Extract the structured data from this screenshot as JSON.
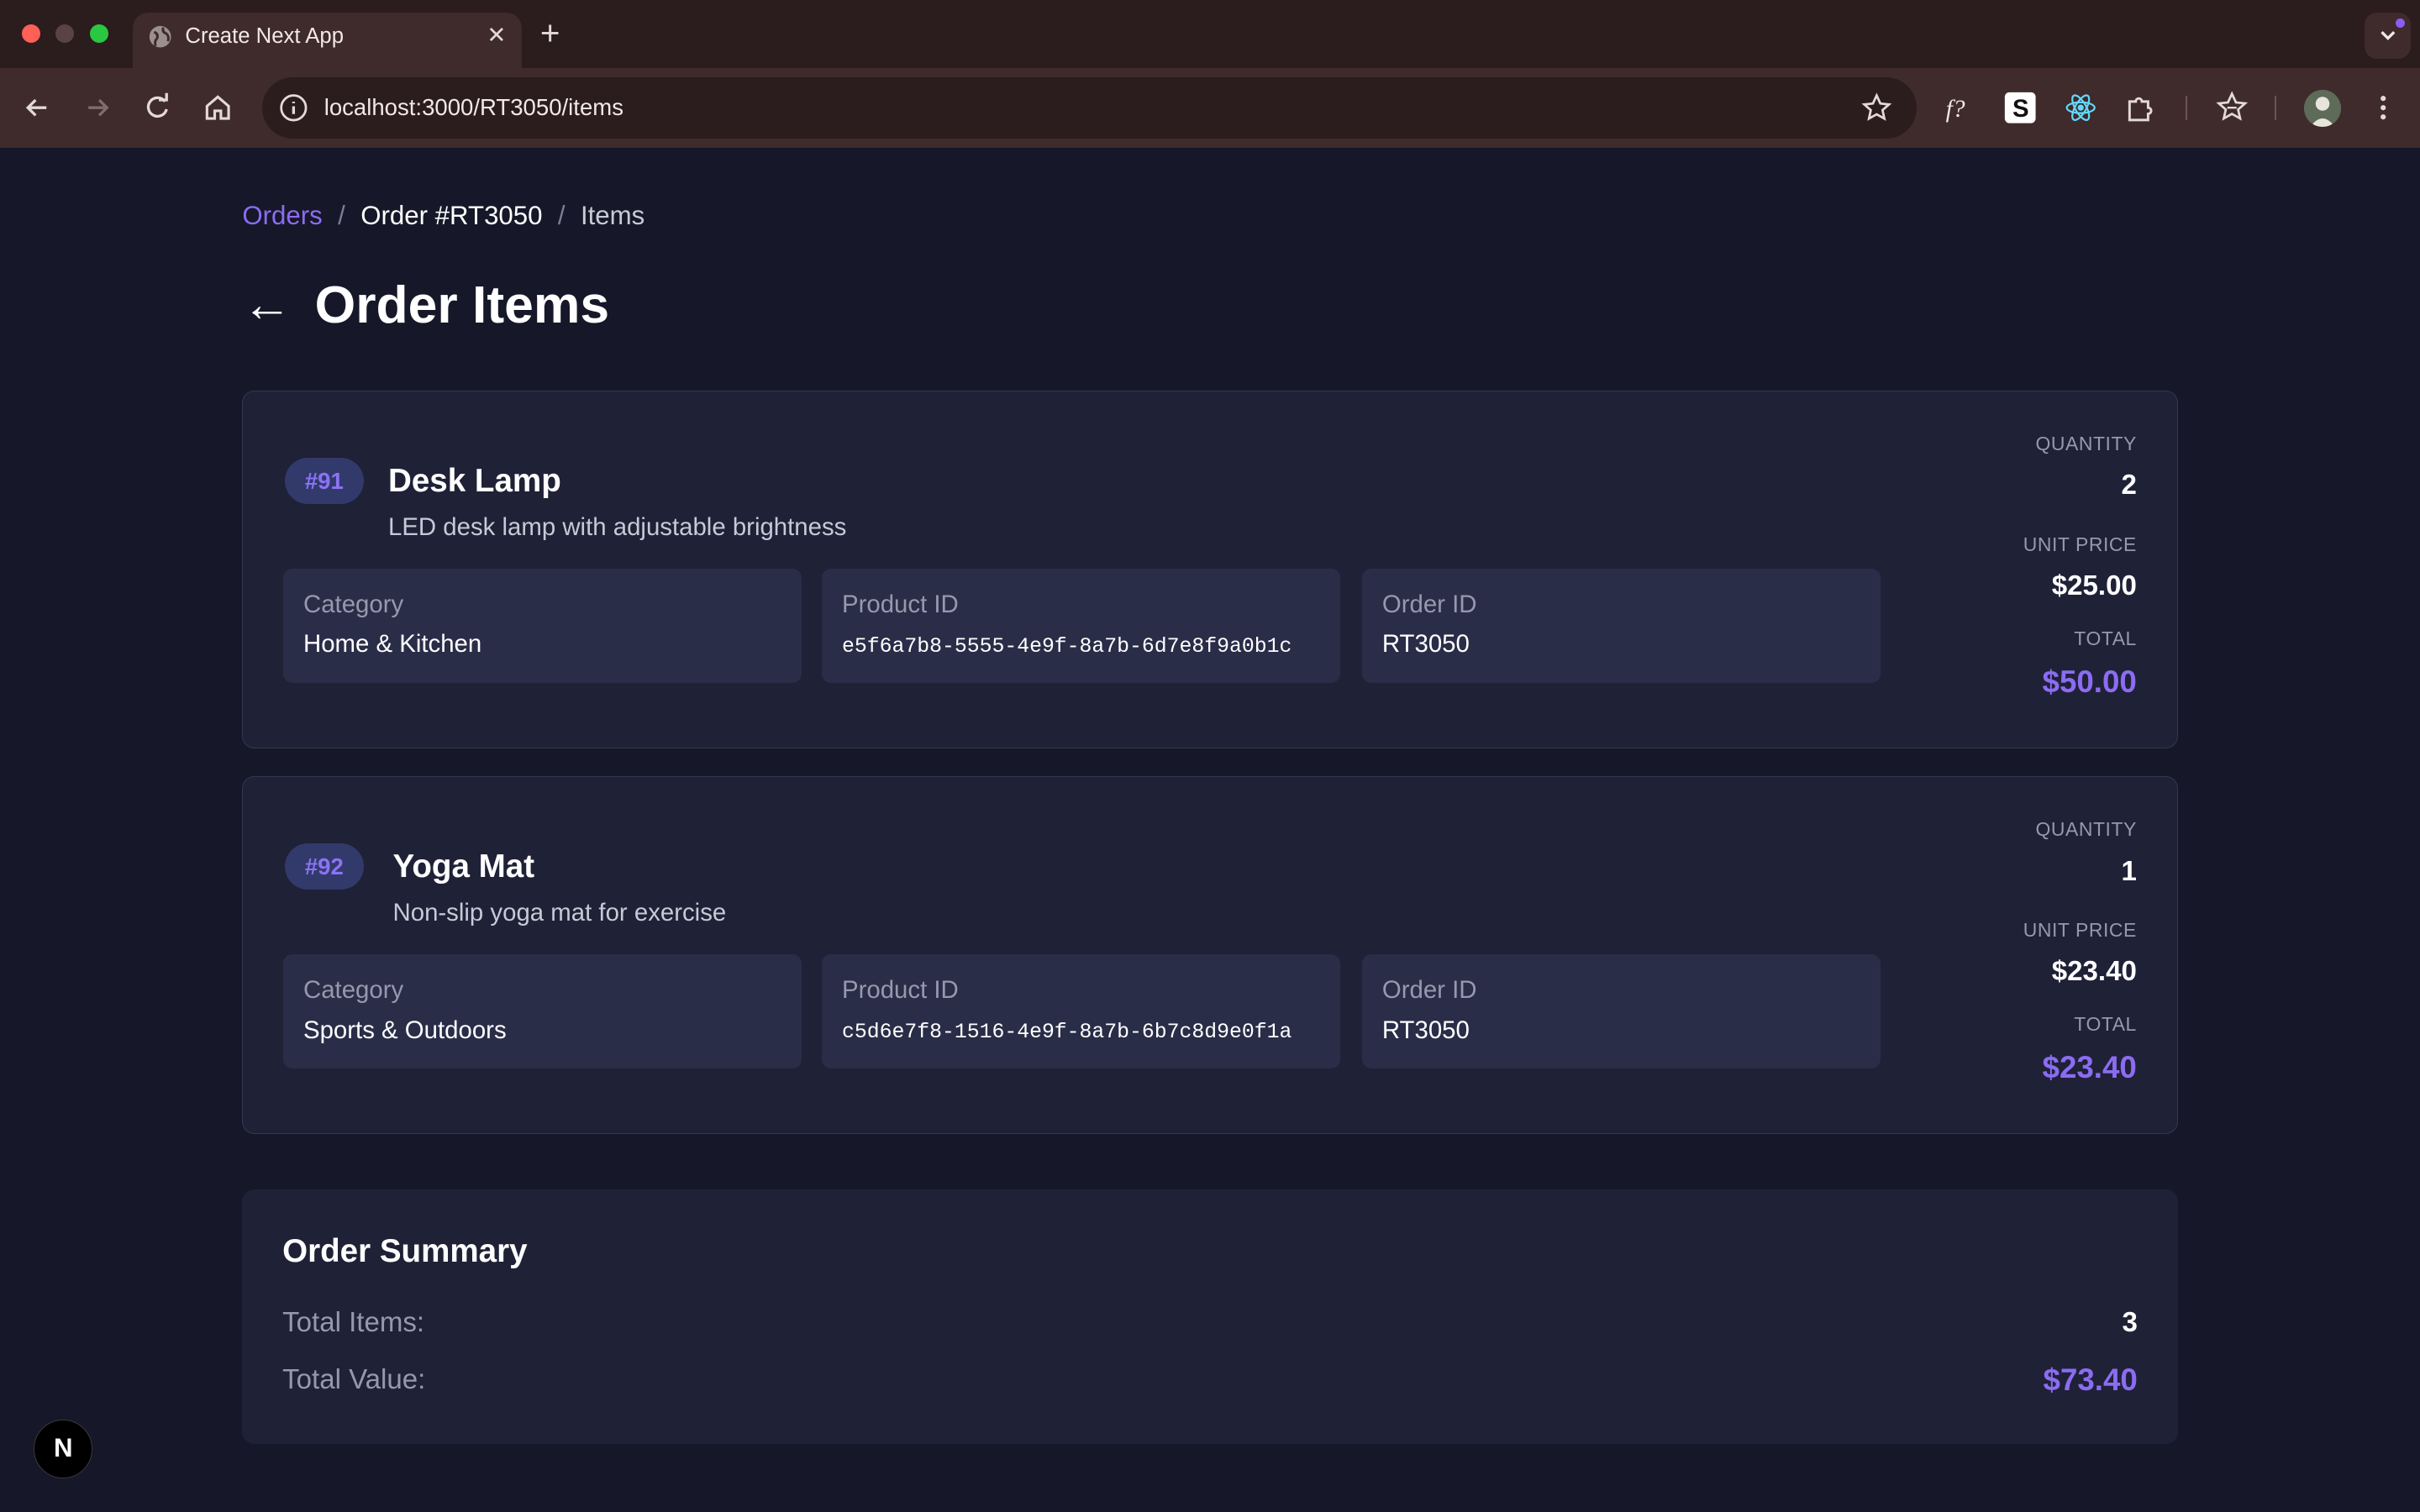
{
  "browser": {
    "tab_title": "Create Next App",
    "tab_close": "✕",
    "new_tab": "+",
    "url": "localhost:3000/RT3050/items",
    "extensions": [
      "formula-icon",
      "s-extension-icon",
      "react-icon",
      "puzzle-icon",
      "bookmark-star-icon"
    ]
  },
  "breadcrumb": {
    "orders": "Orders",
    "order": "Order #RT3050",
    "items": "Items",
    "separator": "/"
  },
  "header": {
    "back": "←",
    "title": "Order Items"
  },
  "items": [
    {
      "badge": "#91",
      "name": "Desk Lamp",
      "description": "LED desk lamp with adjustable brightness",
      "category_label": "Category",
      "category": "Home & Kitchen",
      "product_id_label": "Product ID",
      "product_id": "e5f6a7b8-5555-4e9f-8a7b-6d7e8f9a0b1c",
      "order_id_label": "Order ID",
      "order_id": "RT3050",
      "quantity_label": "QUANTITY",
      "quantity": "2",
      "unit_price_label": "UNIT PRICE",
      "unit_price": "$25.00",
      "total_label": "TOTAL",
      "total": "$50.00"
    },
    {
      "badge": "#92",
      "name": "Yoga Mat",
      "description": "Non-slip yoga mat for exercise",
      "category_label": "Category",
      "category": "Sports & Outdoors",
      "product_id_label": "Product ID",
      "product_id": "c5d6e7f8-1516-4e9f-8a7b-6b7c8d9e0f1a",
      "order_id_label": "Order ID",
      "order_id": "RT3050",
      "quantity_label": "QUANTITY",
      "quantity": "1",
      "unit_price_label": "UNIT PRICE",
      "unit_price": "$23.40",
      "total_label": "TOTAL",
      "total": "$23.40"
    }
  ],
  "summary": {
    "title": "Order Summary",
    "total_items_label": "Total Items:",
    "total_items": "3",
    "total_value_label": "Total Value:",
    "total_value": "$73.40"
  },
  "next_badge": "N",
  "colors": {
    "accent": "#8b6cf2",
    "background": "#161728",
    "card": "#1f2137",
    "chrome": "#3f2a2c"
  }
}
